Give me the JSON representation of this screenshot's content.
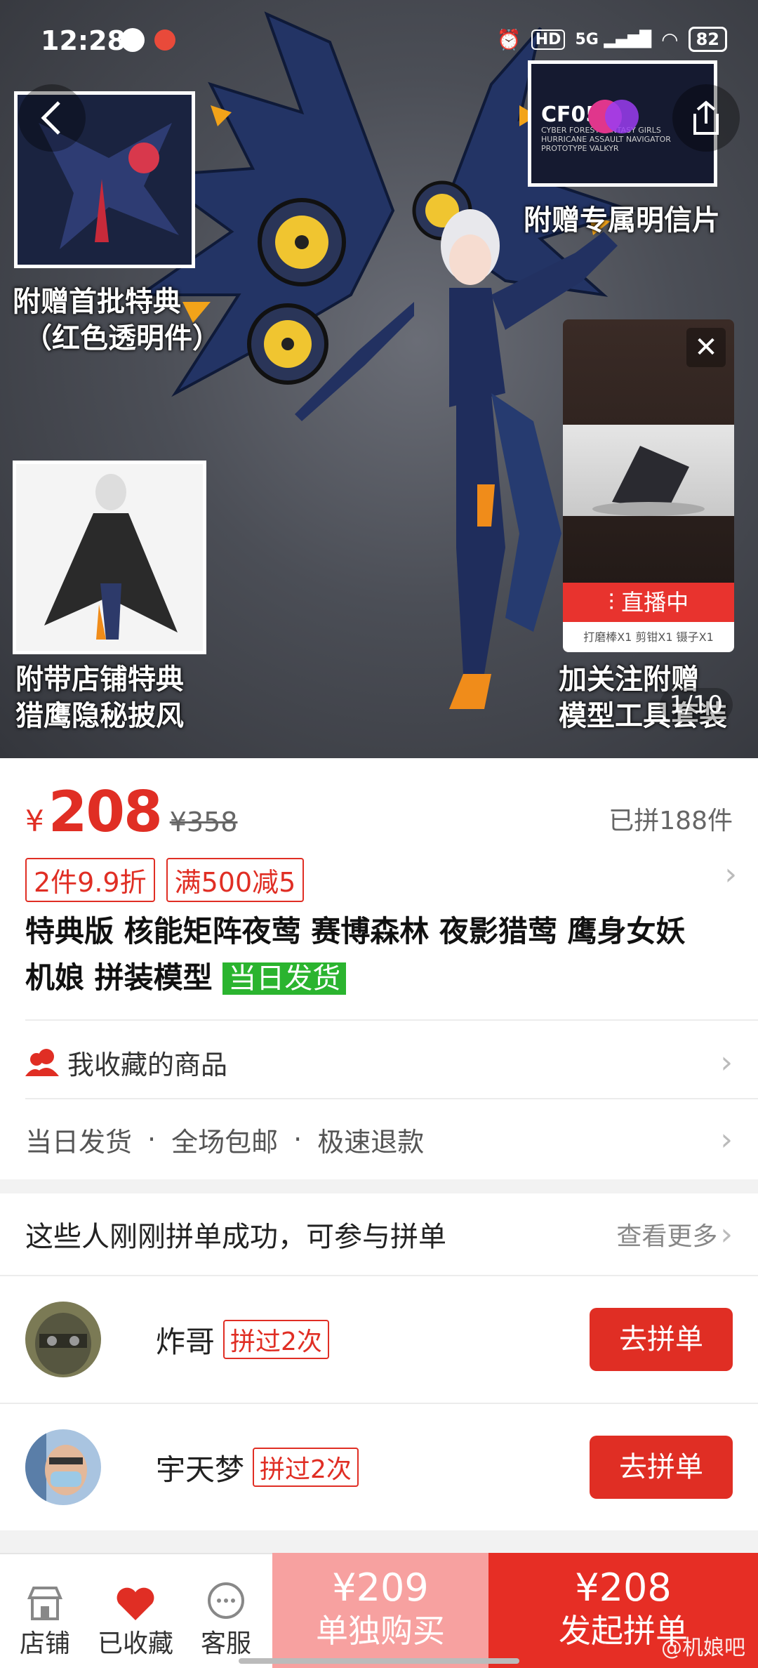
{
  "status": {
    "time": "12:28",
    "network": "5G",
    "hd": "HD",
    "battery": "82"
  },
  "hero": {
    "promo_top_left": [
      "附赠首批特典",
      "（红色透明件）"
    ],
    "promo_top_right": "附赠专属明信片",
    "promo_bottom_left": [
      "附带店铺特典",
      "猎鹰隐秘披风"
    ],
    "promo_bottom_right": [
      "加关注附赠",
      "模型工具套装"
    ],
    "counter": "1/10",
    "postcard_text": [
      "CF05",
      "CYBER FOREST FANTASY GIRLS",
      "HURRICANE ASSAULT NAVIGATOR",
      "PROTOTYPE VALKYR"
    ]
  },
  "live": {
    "badge": "直播中",
    "tools": "打磨棒X1   剪钳X1   镊子X1",
    "close_icon": "close-icon"
  },
  "price": {
    "symbol": "¥",
    "current": "208",
    "original": "¥358",
    "sold": "已拼188件",
    "tags": [
      "2件9.9折",
      "满500减5"
    ]
  },
  "product": {
    "title_line1": "特典版 核能矩阵夜莺 赛博森林 夜影猎莺 鹰身女妖",
    "title_line2": "机娘 拼装模型",
    "green_tag": "当日发货"
  },
  "rows": {
    "collected": "我收藏的商品",
    "services": [
      "当日发货",
      "全场包邮",
      "极速退款"
    ],
    "separator": "·"
  },
  "group": {
    "heading": "这些人刚刚拼单成功，可参与拼单",
    "more": "查看更多",
    "users": [
      {
        "name": "炸哥",
        "times": "拼过2次",
        "button": "去拼单"
      },
      {
        "name": "宇天梦",
        "times": "拼过2次",
        "button": "去拼单"
      }
    ]
  },
  "bottom": {
    "tabs": [
      {
        "label": "店铺",
        "icon": "store-icon"
      },
      {
        "label": "已收藏",
        "icon": "heart-icon"
      },
      {
        "label": "客服",
        "icon": "chat-icon"
      }
    ],
    "single": {
      "price": "¥209",
      "label": "单独购买"
    },
    "group": {
      "price": "¥208",
      "label": "发起拼单"
    },
    "watermark": "@机娘吧"
  },
  "colors": {
    "accent": "#e02e24",
    "green": "#2bb42f",
    "single_buy": "#f7a1a0",
    "group_buy": "#e62e25"
  }
}
